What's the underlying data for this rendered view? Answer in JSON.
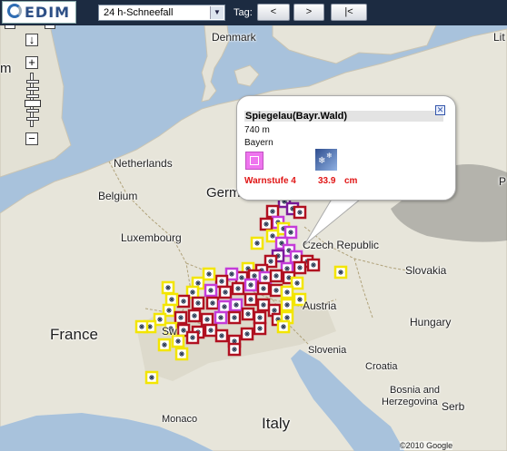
{
  "header": {
    "logo_text": "EDIM",
    "select_value": "24 h-Schneefall",
    "tag_label": "Tag:",
    "prev_button": "<",
    "next_button": ">",
    "latest_button": "|<"
  },
  "map_controls": {
    "down": "↓",
    "zoom_in": "+",
    "zoom_out": "−",
    "left_partial": ""
  },
  "map_labels": {
    "denmark": "Denmark",
    "netherlands": "Netherlands",
    "belgium": "Belgium",
    "germany": "Germ",
    "luxembourg": "Luxembourg",
    "czech": "Czech Republic",
    "slovakia": "Slovakia",
    "austria": "Austria",
    "hungary": "Hungary",
    "france": "France",
    "switzerland": "Sw",
    "slovenia": "Slovenia",
    "croatia": "Croatia",
    "bosnia1": "Bosnia and",
    "bosnia2": "Herzegovina",
    "monaco": "Monaco",
    "italy": "Italy",
    "serbia": "Serb",
    "edge_top_right": "Lit",
    "edge_left": "m",
    "edge_right": "P"
  },
  "popup": {
    "title": "Spiegelau(Bayr.Wald)",
    "elevation": "740 m",
    "region": "Bayern",
    "warning": "Warnstufe 4",
    "snowfall_value": "33.9",
    "snowfall_unit": "cm"
  },
  "markers": {
    "note": "",
    "colors": {
      "yellow": "#f3e500",
      "red": "#b01020",
      "magenta": "#c43cd8",
      "purple": "#7a1a9a"
    },
    "icon": "snowflake-icon"
  },
  "footer": {
    "copyright": "©2010 Google"
  }
}
